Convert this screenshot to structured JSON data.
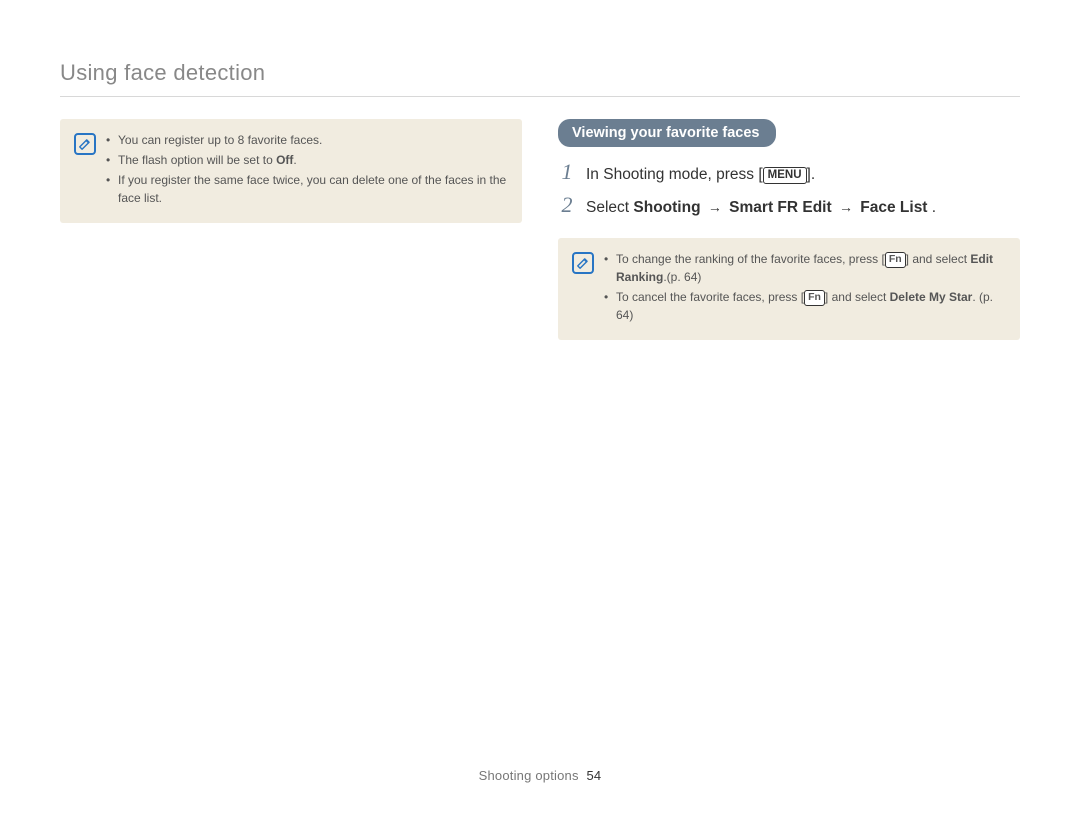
{
  "page_title": "Using face detection",
  "left": {
    "notes": [
      {
        "parts": [
          {
            "t": "You can register up to 8 favorite faces."
          }
        ]
      },
      {
        "parts": [
          {
            "t": "The flash option will be set to "
          },
          {
            "t": "Off",
            "bold": true
          },
          {
            "t": "."
          }
        ]
      },
      {
        "parts": [
          {
            "t": "If you register the same face twice, you can delete one of the faces in the face list."
          }
        ]
      }
    ]
  },
  "right": {
    "heading": "Viewing your favorite faces",
    "steps": [
      {
        "num": "1",
        "parts": [
          {
            "t": "In Shooting mode, press ["
          },
          {
            "key": "MENU"
          },
          {
            "t": "]."
          }
        ]
      },
      {
        "num": "2",
        "parts": [
          {
            "t": "Select "
          },
          {
            "t": "Shooting",
            "bold": true
          },
          {
            "t": " "
          },
          {
            "arrow": true
          },
          {
            "t": " "
          },
          {
            "t": "Smart FR Edit",
            "bold": true
          },
          {
            "t": " "
          },
          {
            "arrow": true
          },
          {
            "t": " "
          },
          {
            "t": "Face List",
            "bold": true
          },
          {
            "t": " ."
          }
        ]
      }
    ],
    "notes": [
      {
        "parts": [
          {
            "t": "To change the ranking of the favorite faces, press ["
          },
          {
            "key": "Fn",
            "small": true
          },
          {
            "t": "] and select "
          },
          {
            "t": "Edit Ranking",
            "bold": true
          },
          {
            "t": ".(p. 64)"
          }
        ]
      },
      {
        "parts": [
          {
            "t": "To cancel the favorite faces, press ["
          },
          {
            "key": "Fn",
            "small": true
          },
          {
            "t": "] and select "
          },
          {
            "t": "Delete My Star",
            "bold": true
          },
          {
            "t": ". (p. 64)"
          }
        ]
      }
    ]
  },
  "footer": {
    "section": "Shooting options",
    "page": "54"
  },
  "icons": {
    "note": "note-pencil-icon"
  }
}
